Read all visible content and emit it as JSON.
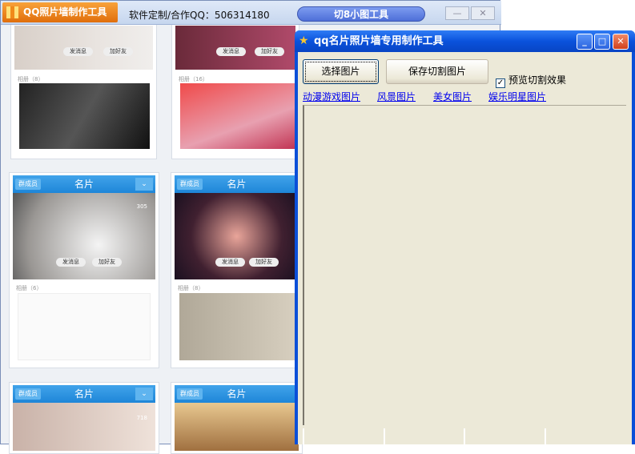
{
  "main_window": {
    "logo": "QQ照片墙制作工具",
    "contact": "软件定制/合作QQ：506314180",
    "cut_tool_button": "切8小图工具",
    "minimize": "—",
    "close": "✕",
    "cards": [
      {
        "album": "相册（8）",
        "send_msg": "发消息",
        "add_friend": "加好友"
      },
      {
        "album": "相册（16）",
        "send_msg": "发消息",
        "add_friend": "加好友"
      },
      {
        "title": "名片",
        "group": "群成员",
        "album": "相册（6）",
        "likes": "305",
        "send_msg": "发消息",
        "add_friend": "加好友"
      },
      {
        "title": "名片",
        "group": "群成员",
        "album": "相册（8）",
        "send_msg": "发消息",
        "add_friend": "加好友"
      },
      {
        "title": "名片",
        "group": "群成员",
        "likes": "718"
      },
      {
        "title": "名片",
        "group": "群成员"
      }
    ]
  },
  "dialog": {
    "title": "qq名片照片墙专用制作工具",
    "select_image": "选择图片",
    "save_cut": "保存切割图片",
    "preview_checkbox": {
      "label": "预览切割效果",
      "checked": true
    },
    "links": [
      "动漫游戏图片",
      "风景图片",
      "美女图片",
      "娱乐明星图片"
    ]
  }
}
